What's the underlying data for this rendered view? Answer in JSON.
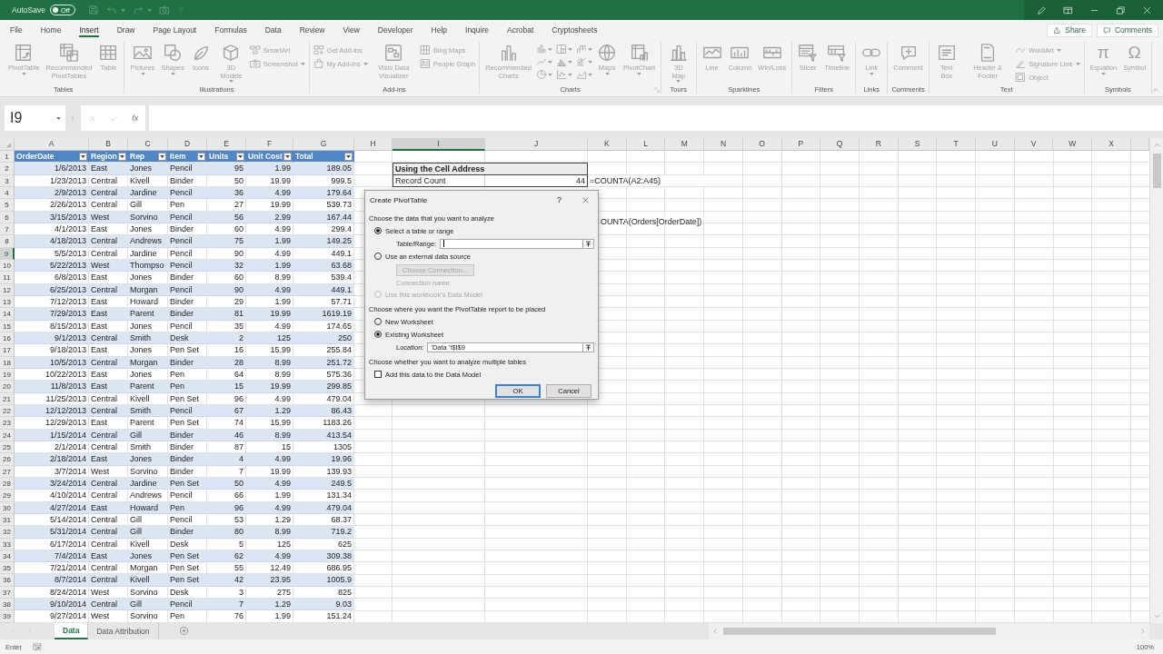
{
  "title_bar": {
    "autosave_label": "AutoSave",
    "autosave": {
      "label": "Off",
      "on": false
    }
  },
  "menu_tabs": [
    {
      "label": "File",
      "selected": false
    },
    {
      "label": "Home",
      "selected": false
    },
    {
      "label": "Insert",
      "selected": true
    },
    {
      "label": "Draw",
      "selected": false
    },
    {
      "label": "Page Layout",
      "selected": false
    },
    {
      "label": "Formulas",
      "selected": false
    },
    {
      "label": "Data",
      "selected": false
    },
    {
      "label": "Review",
      "selected": false
    },
    {
      "label": "View",
      "selected": false
    },
    {
      "label": "Developer",
      "selected": false
    },
    {
      "label": "Help",
      "selected": false
    },
    {
      "label": "Inquire",
      "selected": false
    },
    {
      "label": "Acrobat",
      "selected": false
    },
    {
      "label": "Cryptosheets",
      "selected": false
    }
  ],
  "share_button": {
    "label": "Share"
  },
  "comments_button": {
    "label": "Comments"
  },
  "ribbon": {
    "disabled": true,
    "groups": [
      {
        "label": "Tables",
        "launcher": false,
        "items": [
          {
            "kind": "large",
            "label": "PivotTable",
            "menu": true
          },
          {
            "kind": "large",
            "label": "Recommended PivotTables",
            "menu": false
          },
          {
            "kind": "large",
            "label": "Table",
            "menu": false
          }
        ]
      },
      {
        "label": "Illustrations",
        "launcher": false,
        "items": [
          {
            "kind": "large",
            "label": "Pictures",
            "menu": true
          },
          {
            "kind": "large",
            "label": "Shapes",
            "menu": true
          },
          {
            "kind": "large",
            "label": "Icons",
            "menu": false
          },
          {
            "kind": "large",
            "label": "3D Models",
            "menu": true
          },
          {
            "kind": "stack",
            "items": [
              {
                "label": "SmartArt",
                "menu": false
              },
              {
                "label": "Screenshot",
                "menu": true
              }
            ]
          }
        ]
      },
      {
        "label": "Add-ins",
        "launcher": false,
        "items": [
          {
            "kind": "stack",
            "items": [
              {
                "label": "Get Add-ins",
                "menu": false
              },
              {
                "label": "My Add-ins",
                "menu": true
              }
            ]
          },
          {
            "kind": "large",
            "label": "Visio Data Visualizer",
            "menu": false
          },
          {
            "kind": "stack",
            "items": [
              {
                "label": "Bing Maps",
                "menu": false
              },
              {
                "label": "People Graph",
                "menu": false
              }
            ]
          }
        ]
      },
      {
        "label": "Charts",
        "launcher": true,
        "items": [
          {
            "kind": "large",
            "label": "Recommended Charts",
            "menu": false
          },
          {
            "kind": "chart_grid"
          },
          {
            "kind": "large",
            "label": "Maps",
            "menu": true
          },
          {
            "kind": "large",
            "label": "PivotChart",
            "menu": true
          }
        ]
      },
      {
        "label": "Tours",
        "launcher": false,
        "items": [
          {
            "kind": "large",
            "label": "3D Map",
            "menu": true
          }
        ]
      },
      {
        "label": "Sparklines",
        "launcher": false,
        "items": [
          {
            "kind": "large",
            "label": "Line",
            "menu": false
          },
          {
            "kind": "large",
            "label": "Column",
            "menu": false
          },
          {
            "kind": "large",
            "label": "Win/Loss",
            "menu": false
          }
        ]
      },
      {
        "label": "Filters",
        "launcher": false,
        "items": [
          {
            "kind": "large",
            "label": "Slicer",
            "menu": false
          },
          {
            "kind": "large",
            "label": "Timeline",
            "menu": false
          }
        ]
      },
      {
        "label": "Links",
        "launcher": false,
        "items": [
          {
            "kind": "large",
            "label": "Link",
            "menu": true
          }
        ]
      },
      {
        "label": "Comments",
        "launcher": false,
        "items": [
          {
            "kind": "large",
            "label": "Comment",
            "menu": false
          }
        ]
      },
      {
        "label": "Text",
        "launcher": false,
        "items": [
          {
            "kind": "large",
            "label": "Text Box",
            "menu": false
          },
          {
            "kind": "large",
            "label": "Header & Footer",
            "menu": false
          },
          {
            "kind": "stack",
            "items": [
              {
                "label": "WordArt",
                "menu": true
              },
              {
                "label": "Signature Line",
                "menu": true
              },
              {
                "label": "Object",
                "menu": false
              }
            ]
          }
        ]
      },
      {
        "label": "Symbols",
        "launcher": false,
        "items": [
          {
            "kind": "large",
            "label": "Equation",
            "glyph": "π",
            "menu": true
          },
          {
            "kind": "large",
            "label": "Symbol",
            "glyph": "Ω",
            "menu": false
          }
        ]
      }
    ]
  },
  "name_box": {
    "value": "I9"
  },
  "formula_bar": {
    "function_label": "fx"
  },
  "column_headers": [
    {
      "label": "A",
      "selected": false
    },
    {
      "label": "B",
      "selected": false
    },
    {
      "label": "C",
      "selected": false
    },
    {
      "label": "D",
      "selected": false
    },
    {
      "label": "E",
      "selected": false
    },
    {
      "label": "F",
      "selected": false
    },
    {
      "label": "G",
      "selected": false
    },
    {
      "label": "H",
      "selected": false
    },
    {
      "label": "I",
      "selected": true
    },
    {
      "label": "J",
      "selected": false
    },
    {
      "label": "K",
      "selected": false
    },
    {
      "label": "L",
      "selected": false
    },
    {
      "label": "M",
      "selected": false
    },
    {
      "label": "N",
      "selected": false
    },
    {
      "label": "O",
      "selected": false
    },
    {
      "label": "P",
      "selected": false
    },
    {
      "label": "Q",
      "selected": false
    },
    {
      "label": "R",
      "selected": false
    },
    {
      "label": "S",
      "selected": false
    },
    {
      "label": "T",
      "selected": false
    },
    {
      "label": "U",
      "selected": false
    },
    {
      "label": "V",
      "selected": false
    },
    {
      "label": "W",
      "selected": false
    },
    {
      "label": "X",
      "selected": false
    }
  ],
  "row_headers": [
    {
      "label": "1",
      "selected": false
    },
    {
      "label": "2",
      "selected": false
    },
    {
      "label": "3",
      "selected": false
    },
    {
      "label": "4",
      "selected": false
    },
    {
      "label": "5",
      "selected": false
    },
    {
      "label": "6",
      "selected": false
    },
    {
      "label": "7",
      "selected": false
    },
    {
      "label": "8",
      "selected": false
    },
    {
      "label": "9",
      "selected": true
    },
    {
      "label": "10",
      "selected": false
    },
    {
      "label": "11",
      "selected": false
    },
    {
      "label": "12",
      "selected": false
    },
    {
      "label": "13",
      "selected": false
    },
    {
      "label": "14",
      "selected": false
    },
    {
      "label": "15",
      "selected": false
    },
    {
      "label": "16",
      "selected": false
    },
    {
      "label": "17",
      "selected": false
    },
    {
      "label": "18",
      "selected": false
    },
    {
      "label": "19",
      "selected": false
    },
    {
      "label": "20",
      "selected": false
    },
    {
      "label": "21",
      "selected": false
    },
    {
      "label": "22",
      "selected": false
    },
    {
      "label": "23",
      "selected": false
    },
    {
      "label": "24",
      "selected": false
    },
    {
      "label": "25",
      "selected": false
    },
    {
      "label": "26",
      "selected": false
    },
    {
      "label": "27",
      "selected": false
    },
    {
      "label": "28",
      "selected": false
    },
    {
      "label": "29",
      "selected": false
    },
    {
      "label": "30",
      "selected": false
    },
    {
      "label": "31",
      "selected": false
    },
    {
      "label": "32",
      "selected": false
    },
    {
      "label": "33",
      "selected": false
    },
    {
      "label": "34",
      "selected": false
    },
    {
      "label": "35",
      "selected": false
    },
    {
      "label": "36",
      "selected": false
    },
    {
      "label": "37",
      "selected": false
    },
    {
      "label": "38",
      "selected": false
    },
    {
      "label": "39",
      "selected": false
    }
  ],
  "table": {
    "columns": [
      "OrderDate",
      "Region",
      "Rep",
      "Item",
      "Units",
      "Unit Cost",
      "Total"
    ],
    "rows": [
      [
        "1/6/2013",
        "East",
        "Jones",
        "Pencil",
        "95",
        "1.99",
        "189.05"
      ],
      [
        "1/23/2013",
        "Central",
        "Kivell",
        "Binder",
        "50",
        "19.99",
        "999.5"
      ],
      [
        "2/9/2013",
        "Central",
        "Jardine",
        "Pencil",
        "36",
        "4.99",
        "179.64"
      ],
      [
        "2/26/2013",
        "Central",
        "Gill",
        "Pen",
        "27",
        "19.99",
        "539.73"
      ],
      [
        "3/15/2013",
        "West",
        "Sorvino",
        "Pencil",
        "56",
        "2.99",
        "167.44"
      ],
      [
        "4/1/2013",
        "East",
        "Jones",
        "Binder",
        "60",
        "4.99",
        "299.4"
      ],
      [
        "4/18/2013",
        "Central",
        "Andrews",
        "Pencil",
        "75",
        "1.99",
        "149.25"
      ],
      [
        "5/5/2013",
        "Central",
        "Jardine",
        "Pencil",
        "90",
        "4.99",
        "449.1"
      ],
      [
        "5/22/2013",
        "West",
        "Thompso",
        "Pencil",
        "32",
        "1.99",
        "63.68"
      ],
      [
        "6/8/2013",
        "East",
        "Jones",
        "Binder",
        "60",
        "8.99",
        "539.4"
      ],
      [
        "6/25/2013",
        "Central",
        "Morgan",
        "Pencil",
        "90",
        "4.99",
        "449.1"
      ],
      [
        "7/12/2013",
        "East",
        "Howard",
        "Binder",
        "29",
        "1.99",
        "57.71"
      ],
      [
        "7/29/2013",
        "East",
        "Parent",
        "Binder",
        "81",
        "19.99",
        "1619.19"
      ],
      [
        "8/15/2013",
        "East",
        "Jones",
        "Pencil",
        "35",
        "4.99",
        "174.65"
      ],
      [
        "9/1/2013",
        "Central",
        "Smith",
        "Desk",
        "2",
        "125",
        "250"
      ],
      [
        "9/18/2013",
        "East",
        "Jones",
        "Pen Set",
        "16",
        "15.99",
        "255.84"
      ],
      [
        "10/5/2013",
        "Central",
        "Morgan",
        "Binder",
        "28",
        "8.99",
        "251.72"
      ],
      [
        "10/22/2013",
        "East",
        "Jones",
        "Pen",
        "64",
        "8.99",
        "575.36"
      ],
      [
        "11/8/2013",
        "East",
        "Parent",
        "Pen",
        "15",
        "19.99",
        "299.85"
      ],
      [
        "11/25/2013",
        "Central",
        "Kivell",
        "Pen Set",
        "96",
        "4.99",
        "479.04"
      ],
      [
        "12/12/2013",
        "Central",
        "Smith",
        "Pencil",
        "67",
        "1.29",
        "86.43"
      ],
      [
        "12/29/2013",
        "East",
        "Parent",
        "Pen Set",
        "74",
        "15.99",
        "1183.26"
      ],
      [
        "1/15/2014",
        "Central",
        "Gill",
        "Binder",
        "46",
        "8.99",
        "413.54"
      ],
      [
        "2/1/2014",
        "Central",
        "Smith",
        "Binder",
        "87",
        "15",
        "1305"
      ],
      [
        "2/18/2014",
        "East",
        "Jones",
        "Binder",
        "4",
        "4.99",
        "19.96"
      ],
      [
        "3/7/2014",
        "West",
        "Sorvino",
        "Binder",
        "7",
        "19.99",
        "139.93"
      ],
      [
        "3/24/2014",
        "Central",
        "Jardine",
        "Pen Set",
        "50",
        "4.99",
        "249.5"
      ],
      [
        "4/10/2014",
        "Central",
        "Andrews",
        "Pencil",
        "66",
        "1.99",
        "131.34"
      ],
      [
        "4/27/2014",
        "East",
        "Howard",
        "Pen",
        "96",
        "4.99",
        "479.04"
      ],
      [
        "5/14/2014",
        "Central",
        "Gill",
        "Pencil",
        "53",
        "1.29",
        "68.37"
      ],
      [
        "5/31/2014",
        "Central",
        "Gill",
        "Binder",
        "80",
        "8.99",
        "719.2"
      ],
      [
        "6/17/2014",
        "Central",
        "Kivell",
        "Desk",
        "5",
        "125",
        "625"
      ],
      [
        "7/4/2014",
        "East",
        "Jones",
        "Pen Set",
        "62",
        "4.99",
        "309.38"
      ],
      [
        "7/21/2014",
        "Central",
        "Morgan",
        "Pen Set",
        "55",
        "12.49",
        "686.95"
      ],
      [
        "8/7/2014",
        "Central",
        "Kivell",
        "Pen Set",
        "42",
        "23.95",
        "1005.9"
      ],
      [
        "8/24/2014",
        "West",
        "Sorvino",
        "Desk",
        "3",
        "275",
        "825"
      ],
      [
        "9/10/2014",
        "Central",
        "Gill",
        "Pencil",
        "7",
        "1.29",
        "9.03"
      ],
      [
        "9/27/2014",
        "West",
        "Sorvino",
        "Pen",
        "76",
        "1.99",
        "151.24"
      ]
    ]
  },
  "summary_box": {
    "title": "Using the Cell Address",
    "label": "Record Count",
    "value": "44",
    "formula": "=COUNTA(A2:A45)"
  },
  "formula_note": "OUNTA(Orders[OrderDate])",
  "dialog": {
    "title": "Create PivotTable",
    "help_label": "?",
    "source_heading": "Choose the data that you want to analyze",
    "source_options": [
      {
        "label": "Select a table or range",
        "selected": true,
        "disabled": false
      },
      {
        "label": "Use an external data source",
        "selected": false,
        "disabled": false
      },
      {
        "label": "Use this workbook's Data Model",
        "selected": false,
        "disabled": true
      }
    ],
    "table_range": {
      "label": "Table/Range:",
      "focused": true
    },
    "connection_button": {
      "label": "Choose Connection...",
      "disabled": true
    },
    "connection_name": {
      "label": "Connection name:",
      "disabled": true
    },
    "placement_heading": "Choose where you want the PivotTable report to be placed",
    "placement_options": [
      {
        "label": "New Worksheet",
        "selected": false
      },
      {
        "label": "Existing Worksheet",
        "selected": true
      }
    ],
    "location": {
      "label": "Location:",
      "value": "'Data '!$I$9"
    },
    "tables_heading": "Choose whether you want to analyze multiple tables",
    "data_model": {
      "label": "Add this data to the Data Model",
      "checked": false
    },
    "buttons": [
      {
        "label": "OK",
        "default": true
      },
      {
        "label": "Cancel",
        "default": false
      }
    ]
  },
  "sheet_tabs": [
    {
      "label": "Data",
      "selected": true
    },
    {
      "label": "Data Attribution",
      "selected": false
    }
  ],
  "status_bar": {
    "mode": "Enter",
    "zoom": "100%"
  }
}
